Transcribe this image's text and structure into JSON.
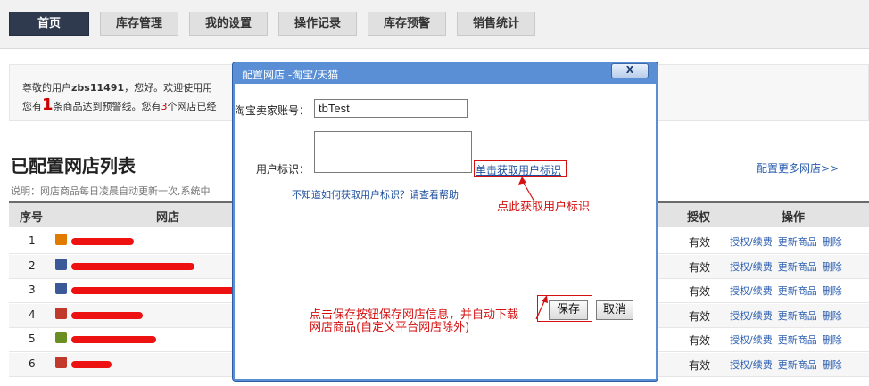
{
  "nav": {
    "tabs": [
      "首页",
      "库存管理",
      "我的设置",
      "操作记录",
      "库存预警",
      "销售统计"
    ]
  },
  "welcome": {
    "line1_prefix": "尊敬的用户",
    "username": "zbs11491",
    "line1_suffix": "，您好。欢迎使用用",
    "line2_prefix": "您有",
    "warn_count": "1",
    "line2_middle": "条商品达到预警线。您有",
    "shop_count": "3",
    "line2_suffix": "个网店已经"
  },
  "section": {
    "title": "已配置网店列表",
    "desc": "说明：网店商品每日凌晨自动更新一次,系统中",
    "more": "配置更多网店>>"
  },
  "table": {
    "headers": {
      "no": "序号",
      "shop": "网店",
      "auth": "授权",
      "ops": "操作"
    },
    "rows": [
      {
        "no": "1",
        "auth": "有效",
        "op1": "授权/续费",
        "op2": "更新商品",
        "op3": "删除",
        "icon_color": "#e07b00",
        "redact_w": 70
      },
      {
        "no": "2",
        "auth": "有效",
        "op1": "授权/续费",
        "op2": "更新商品",
        "op3": "删除",
        "icon_color": "#3b5998",
        "redact_w": 138
      },
      {
        "no": "3",
        "auth": "有效",
        "op1": "授权/续费",
        "op2": "更新商品",
        "op3": "删除",
        "icon_color": "#3b5998",
        "redact_w": 188
      },
      {
        "no": "4",
        "auth": "有效",
        "op1": "授权/续费",
        "op2": "更新商品",
        "op3": "删除",
        "icon_color": "#c0392b",
        "redact_w": 80
      },
      {
        "no": "5",
        "auth": "有效",
        "op1": "授权/续费",
        "op2": "更新商品",
        "op3": "删除",
        "icon_color": "#6b8e23",
        "redact_w": 95
      },
      {
        "no": "6",
        "auth": "有效",
        "op1": "授权/续费",
        "op2": "更新商品",
        "op3": "删除",
        "icon_color": "#c0392b",
        "redact_w": 45
      }
    ]
  },
  "dialog": {
    "title": "配置网店 -淘宝/天猫",
    "close": "X",
    "seller_label": "淘宝卖家账号：",
    "seller_value": "tbTest",
    "userid_label": "用户标识：",
    "userid_value": "",
    "get_id_link": "单击获取用户标识",
    "help_text": "不知道如何获取用户标识？请查看帮助",
    "annotation_get": "点此获取用户标识",
    "annotation_save_1": "点击保存按钮保存网店信息，并自动下载",
    "annotation_save_2": "网店商品(自定义平台网店除外)",
    "save": "保存",
    "cancel": "取消"
  },
  "colors": {
    "annotation": "#d41010",
    "link": "#1d4f9e",
    "dialog_frame": "#5a8fd6",
    "active_tab": "#2f3a4e"
  }
}
